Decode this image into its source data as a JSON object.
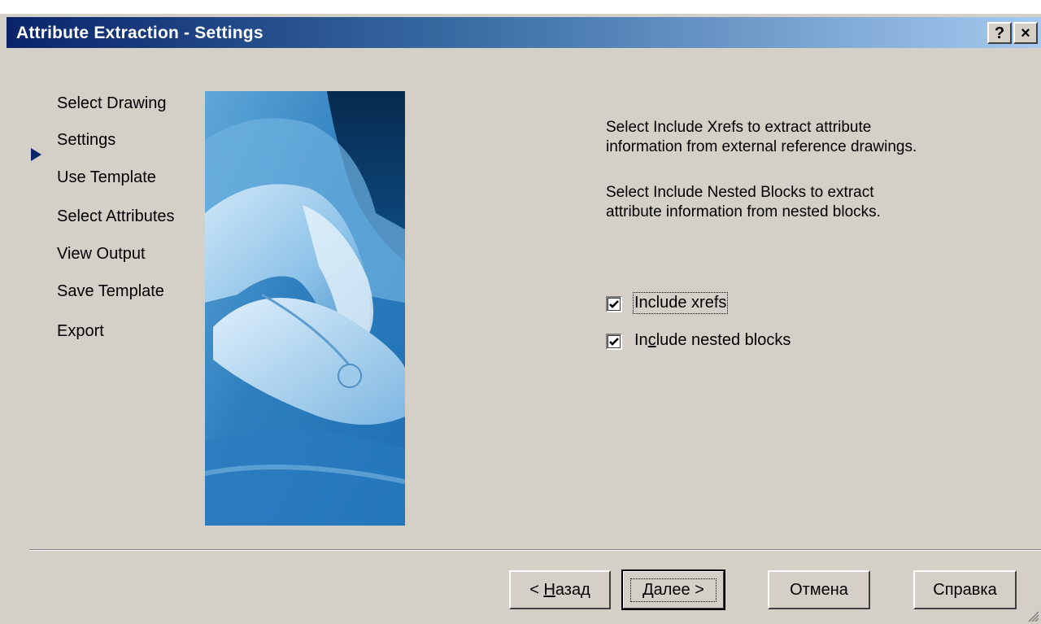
{
  "window": {
    "title": "Attribute Extraction - Settings",
    "help_button": "?",
    "close_button": "×"
  },
  "steps": [
    {
      "label": "Select Drawing"
    },
    {
      "label": "Settings",
      "current": true
    },
    {
      "label": "Use Template"
    },
    {
      "label": "Select Attributes"
    },
    {
      "label": "View Output"
    },
    {
      "label": "Save Template"
    },
    {
      "label": "Export"
    }
  ],
  "description": {
    "xrefs_line1": "Select Include Xrefs to extract attribute",
    "xrefs_line2": "information from external reference drawings.",
    "nested_line1": "Select Include Nested Blocks to extract",
    "nested_line2": "attribute information from nested blocks."
  },
  "options": {
    "include_xrefs": {
      "label": "Include xrefs",
      "checked": true
    },
    "include_nested": {
      "label_pre": "In",
      "label_mnemonic": "c",
      "label_post": "lude nested blocks",
      "checked": true
    }
  },
  "buttons": {
    "back": {
      "pre": "< ",
      "mnemonic": "Н",
      "post": "азад"
    },
    "next": "Далее >",
    "cancel": "Отмена",
    "help": "Справка"
  },
  "colors": {
    "dialog_bg": "#d4d0c8",
    "title_start": "#0a246a",
    "title_end": "#a6caf0",
    "step_arrow": "#0a246a"
  },
  "icons": {
    "current_step": "play-arrow-icon",
    "checkbox_mark": "checkmark-icon"
  }
}
